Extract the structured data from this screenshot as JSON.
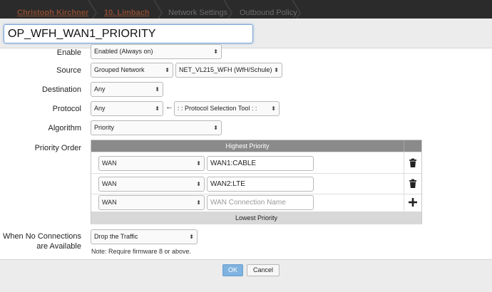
{
  "breadcrumb": {
    "items": [
      "Christoph Kirchner",
      "10. Limbach",
      "Network Settings",
      "Outbound Policy"
    ]
  },
  "policy": {
    "name": "OP_WFH_WAN1_PRIORITY"
  },
  "form": {
    "enable": {
      "label": "Enable",
      "value": "Enabled (Always on)"
    },
    "source": {
      "label": "Source",
      "type_value": "Grouped Network",
      "network_value": "NET_VL215_WFH (WfH/Schule)"
    },
    "destination": {
      "label": "Destination",
      "value": "Any"
    },
    "protocol": {
      "label": "Protocol",
      "value": "Any",
      "tool_value": ": : Protocol Selection Tool : :"
    },
    "algorithm": {
      "label": "Algorithm",
      "value": "Priority"
    },
    "priority_order": {
      "label": "Priority Order",
      "highest_label": "Highest Priority",
      "lowest_label": "Lowest Priority",
      "rows": [
        {
          "type": "WAN",
          "connection": "WAN1:CABLE",
          "action": "delete"
        },
        {
          "type": "WAN",
          "connection": "WAN2:LTE",
          "action": "delete"
        }
      ],
      "new_row": {
        "type": "WAN",
        "placeholder": "WAN Connection Name",
        "action": "add"
      }
    },
    "no_connections": {
      "label_line1": "When No Connections",
      "label_line2": "are Available",
      "value": "Drop the Traffic",
      "note": "Note: Require firmware 8 or above."
    }
  },
  "footer": {
    "ok_label": "OK",
    "cancel_label": "Cancel"
  },
  "colors": {
    "accent": "#7fb2df",
    "breadcrumb_link": "#8a4a30",
    "table_header": "#8a8a8a"
  },
  "icons": {
    "delete": "trash-icon",
    "add": "plus-icon",
    "arrow": "left-arrow-icon",
    "dropdown": "updown-chevron-icon"
  }
}
